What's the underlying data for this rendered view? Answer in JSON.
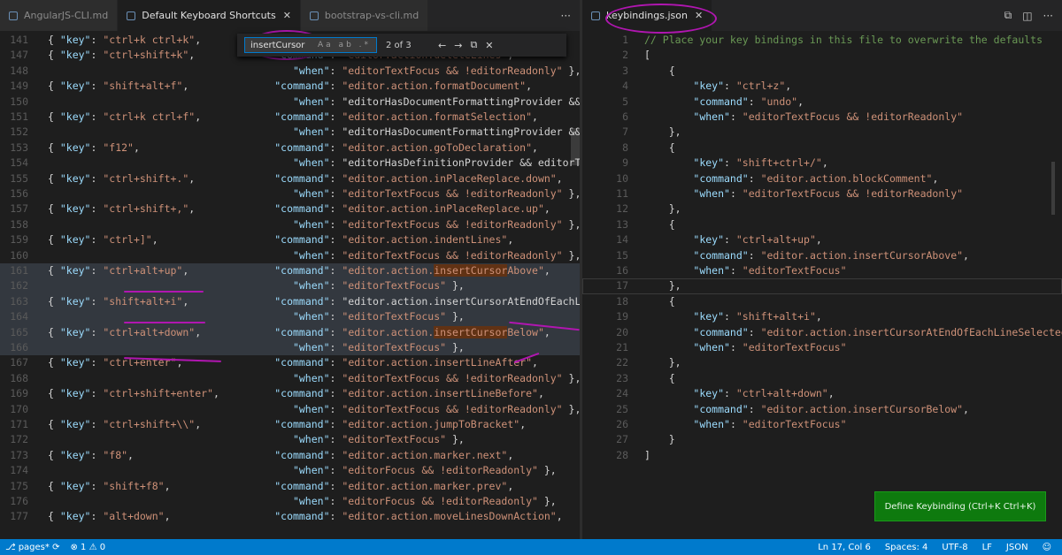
{
  "tabs_left": [
    {
      "label": "AngularJS-CLI.md",
      "active": false
    },
    {
      "label": "Default Keyboard Shortcuts",
      "active": true
    },
    {
      "label": "bootstrap-vs-cli.md",
      "active": false
    }
  ],
  "tab_right": {
    "label": "keybindings.json",
    "close": "✕"
  },
  "find": {
    "value": "insertCursor",
    "options": "Aa ab .*",
    "count": "2 of 3",
    "prev": "←",
    "next": "→",
    "selection": "⧉",
    "close": "✕"
  },
  "left_lines": [
    {
      "n": "141",
      "text": "{ \"key\": \"ctrl+k ctrl+k\","
    },
    {
      "n": "147",
      "text": "{ \"key\": \"ctrl+shift+k\",             \"command\": \"editor.action.deleteLines\","
    },
    {
      "n": "148",
      "text": "                                        \"when\": \"editorTextFocus && !editorReadonly\" },"
    },
    {
      "n": "149",
      "text": "{ \"key\": \"shift+alt+f\",              \"command\": \"editor.action.formatDocument\","
    },
    {
      "n": "150",
      "text": "                                        \"when\": \"editorHasDocumentFormattingProvider && e"
    },
    {
      "n": "151",
      "text": "{ \"key\": \"ctrl+k ctrl+f\",            \"command\": \"editor.action.formatSelection\","
    },
    {
      "n": "152",
      "text": "                                        \"when\": \"editorHasDocumentFormattingProvider &&"
    },
    {
      "n": "153",
      "text": "{ \"key\": \"f12\",                      \"command\": \"editor.action.goToDeclaration\","
    },
    {
      "n": "154",
      "text": "                                        \"when\": \"editorHasDefinitionProvider && editorTe"
    },
    {
      "n": "155",
      "text": "{ \"key\": \"ctrl+shift+.\",             \"command\": \"editor.action.inPlaceReplace.down\","
    },
    {
      "n": "156",
      "text": "                                        \"when\": \"editorTextFocus && !editorReadonly\" },"
    },
    {
      "n": "157",
      "text": "{ \"key\": \"ctrl+shift+,\",             \"command\": \"editor.action.inPlaceReplace.up\","
    },
    {
      "n": "158",
      "text": "                                        \"when\": \"editorTextFocus && !editorReadonly\" },"
    },
    {
      "n": "159",
      "text": "{ \"key\": \"ctrl+]\",                   \"command\": \"editor.action.indentLines\","
    },
    {
      "n": "160",
      "text": "                                        \"when\": \"editorTextFocus && !editorReadonly\" },"
    },
    {
      "n": "161",
      "text": "{ \"key\": \"ctrl+alt+up\",              \"command\": \"editor.action.insertCursorAbove\","
    },
    {
      "n": "162",
      "text": "                                        \"when\": \"editorTextFocus\" },"
    },
    {
      "n": "163",
      "text": "{ \"key\": \"shift+alt+i\",              \"command\": \"editor.action.insertCursorAtEndOfEachLi"
    },
    {
      "n": "164",
      "text": "                                        \"when\": \"editorTextFocus\" },"
    },
    {
      "n": "165",
      "text": "{ \"key\": \"ctrl+alt+down\",            \"command\": \"editor.action.insertCursorBelow\","
    },
    {
      "n": "166",
      "text": "                                        \"when\": \"editorTextFocus\" },"
    },
    {
      "n": "167",
      "text": "{ \"key\": \"ctrl+enter\",               \"command\": \"editor.action.insertLineAfter\","
    },
    {
      "n": "168",
      "text": "                                        \"when\": \"editorTextFocus && !editorReadonly\" },"
    },
    {
      "n": "169",
      "text": "{ \"key\": \"ctrl+shift+enter\",         \"command\": \"editor.action.insertLineBefore\","
    },
    {
      "n": "170",
      "text": "                                        \"when\": \"editorTextFocus && !editorReadonly\" },"
    },
    {
      "n": "171",
      "text": "{ \"key\": \"ctrl+shift+\\\\\",            \"command\": \"editor.action.jumpToBracket\","
    },
    {
      "n": "172",
      "text": "                                        \"when\": \"editorTextFocus\" },"
    },
    {
      "n": "173",
      "text": "{ \"key\": \"f8\",                       \"command\": \"editor.action.marker.next\","
    },
    {
      "n": "174",
      "text": "                                        \"when\": \"editorFocus && !editorReadonly\" },"
    },
    {
      "n": "175",
      "text": "{ \"key\": \"shift+f8\",                 \"command\": \"editor.action.marker.prev\","
    },
    {
      "n": "176",
      "text": "                                        \"when\": \"editorFocus && !editorReadonly\" },"
    },
    {
      "n": "177",
      "text": "{ \"key\": \"alt+down\",                 \"command\": \"editor.action.moveLinesDownAction\","
    }
  ],
  "right_lines": [
    {
      "n": "1",
      "text": "// Place your key bindings in this file to overwrite the defaults"
    },
    {
      "n": "2",
      "text": "["
    },
    {
      "n": "3",
      "text": "    {"
    },
    {
      "n": "4",
      "text": "        \"key\": \"ctrl+z\","
    },
    {
      "n": "5",
      "text": "        \"command\": \"undo\","
    },
    {
      "n": "6",
      "text": "        \"when\": \"editorTextFocus && !editorReadonly\""
    },
    {
      "n": "7",
      "text": "    },"
    },
    {
      "n": "8",
      "text": "    {"
    },
    {
      "n": "9",
      "text": "        \"key\": \"shift+ctrl+/\","
    },
    {
      "n": "10",
      "text": "        \"command\": \"editor.action.blockComment\","
    },
    {
      "n": "11",
      "text": "        \"when\": \"editorTextFocus && !editorReadonly\""
    },
    {
      "n": "12",
      "text": "    },"
    },
    {
      "n": "13",
      "text": "    {"
    },
    {
      "n": "14",
      "text": "        \"key\": \"ctrl+alt+up\","
    },
    {
      "n": "15",
      "text": "        \"command\": \"editor.action.insertCursorAbove\","
    },
    {
      "n": "16",
      "text": "        \"when\": \"editorTextFocus\""
    },
    {
      "n": "17",
      "text": "    },"
    },
    {
      "n": "18",
      "text": "    {"
    },
    {
      "n": "19",
      "text": "        \"key\": \"shift+alt+i\","
    },
    {
      "n": "20",
      "text": "        \"command\": \"editor.action.insertCursorAtEndOfEachLineSelected\","
    },
    {
      "n": "21",
      "text": "        \"when\": \"editorTextFocus\""
    },
    {
      "n": "22",
      "text": "    },"
    },
    {
      "n": "23",
      "text": "    {"
    },
    {
      "n": "24",
      "text": "        \"key\": \"ctrl+alt+down\","
    },
    {
      "n": "25",
      "text": "        \"command\": \"editor.action.insertCursorBelow\","
    },
    {
      "n": "26",
      "text": "        \"when\": \"editorTextFocus\""
    },
    {
      "n": "27",
      "text": "    }"
    },
    {
      "n": "28",
      "text": "]"
    }
  ],
  "define_button": "Define Keybinding (Ctrl+K Ctrl+K)",
  "status": {
    "branch": "pages*",
    "errors": "1",
    "warnings": "0",
    "position": "Ln 17, Col 6",
    "spaces": "Spaces: 4",
    "encoding": "UTF-8",
    "eol": "LF",
    "language": "JSON"
  },
  "icons": {
    "split": "split-editor-icon",
    "more": "more-icon",
    "branch": "branch-icon",
    "sync": "sync-icon"
  }
}
